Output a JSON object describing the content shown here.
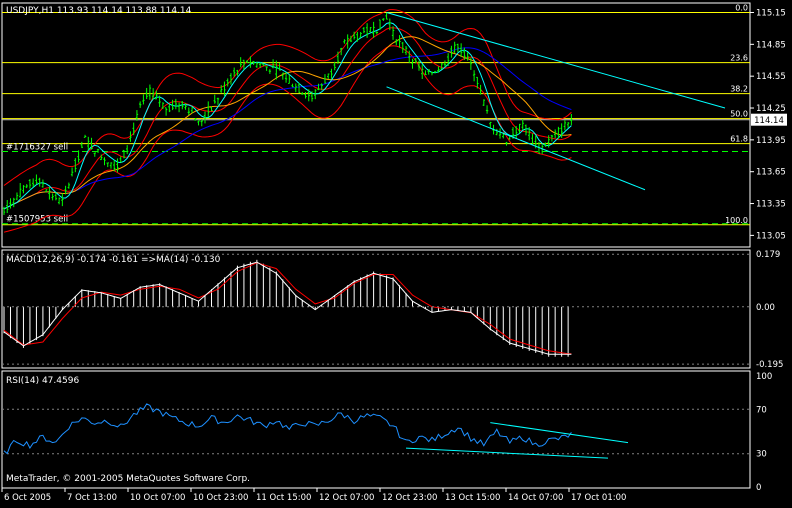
{
  "chart_data": {
    "type": "candlestick",
    "symbol": "USDJPY,H1",
    "title": "USDJPY,H1  113.93 114.14 113.88 114.14",
    "ohlc_header": [
      "113.93",
      "114.14",
      "113.88",
      "114.14"
    ],
    "current_price": 114.14,
    "current_price_label": "114.14",
    "price_ylim": [
      112.95,
      115.23
    ],
    "price_ticks": [
      "115.15",
      "114.85",
      "114.55",
      "114.25",
      "113.95",
      "113.65",
      "113.35",
      "113.05"
    ],
    "time_labels": [
      "6 Oct 2005",
      "7 Oct 13:00",
      "10 Oct 07:00",
      "10 Oct 23:00",
      "11 Oct 15:00",
      "12 Oct 07:00",
      "12 Oct 23:00",
      "13 Oct 15:00",
      "14 Oct 07:00",
      "17 Oct 01:00"
    ],
    "fibonacci": {
      "high": 115.15,
      "low": 113.15,
      "levels": [
        {
          "ratio": 0.0,
          "label": "0.0"
        },
        {
          "ratio": 0.236,
          "label": "23.6"
        },
        {
          "ratio": 0.382,
          "label": "38.2"
        },
        {
          "ratio": 0.5,
          "label": "50.0"
        },
        {
          "ratio": 0.618,
          "label": "61.8"
        },
        {
          "ratio": 1.0,
          "label": "100.0"
        }
      ]
    },
    "orders": [
      {
        "label": "#1716327 sell",
        "price": 113.84
      },
      {
        "label": "#1507953 sell",
        "price": 113.16
      }
    ],
    "price_path": [
      [
        0,
        113.3
      ],
      [
        5,
        113.45
      ],
      [
        10,
        113.58
      ],
      [
        15,
        113.42
      ],
      [
        18,
        113.36
      ],
      [
        22,
        113.72
      ],
      [
        25,
        113.95
      ],
      [
        30,
        113.8
      ],
      [
        35,
        113.7
      ],
      [
        38,
        113.88
      ],
      [
        42,
        114.25
      ],
      [
        45,
        114.4
      ],
      [
        50,
        114.25
      ],
      [
        55,
        114.3
      ],
      [
        58,
        114.22
      ],
      [
        60,
        114.1
      ],
      [
        65,
        114.3
      ],
      [
        70,
        114.55
      ],
      [
        75,
        114.7
      ],
      [
        80,
        114.65
      ],
      [
        85,
        114.6
      ],
      [
        90,
        114.45
      ],
      [
        95,
        114.35
      ],
      [
        100,
        114.55
      ],
      [
        105,
        114.85
      ],
      [
        110,
        114.95
      ],
      [
        115,
        115.0
      ],
      [
        118,
        115.12
      ],
      [
        120,
        114.95
      ],
      [
        125,
        114.75
      ],
      [
        130,
        114.55
      ],
      [
        135,
        114.65
      ],
      [
        140,
        114.85
      ],
      [
        145,
        114.6
      ],
      [
        150,
        114.1
      ],
      [
        155,
        113.95
      ],
      [
        160,
        114.1
      ],
      [
        165,
        113.85
      ],
      [
        170,
        114.0
      ],
      [
        175,
        114.14
      ]
    ],
    "macd": {
      "label": "MACD(12,26,9) -0.174 -0.161 =>MA(14) -0.130",
      "ylim": [
        -0.205,
        0.19
      ],
      "ticks": [
        "0.179",
        "0.00",
        "-0.195"
      ],
      "tick_values": [
        0.179,
        0.0,
        -0.195
      ],
      "histogram": [
        [
          0,
          -0.09
        ],
        [
          6,
          -0.14
        ],
        [
          12,
          -0.1
        ],
        [
          18,
          -0.01
        ],
        [
          24,
          0.06
        ],
        [
          30,
          0.05
        ],
        [
          36,
          0.03
        ],
        [
          42,
          0.07
        ],
        [
          48,
          0.08
        ],
        [
          54,
          0.05
        ],
        [
          60,
          0.02
        ],
        [
          66,
          0.08
        ],
        [
          72,
          0.14
        ],
        [
          78,
          0.16
        ],
        [
          84,
          0.12
        ],
        [
          90,
          0.04
        ],
        [
          96,
          -0.01
        ],
        [
          102,
          0.04
        ],
        [
          108,
          0.09
        ],
        [
          114,
          0.12
        ],
        [
          120,
          0.1
        ],
        [
          126,
          0.02
        ],
        [
          132,
          -0.02
        ],
        [
          138,
          -0.01
        ],
        [
          144,
          -0.02
        ],
        [
          150,
          -0.08
        ],
        [
          156,
          -0.13
        ],
        [
          162,
          -0.15
        ],
        [
          168,
          -0.17
        ],
        [
          174,
          -0.17
        ]
      ],
      "signal": [
        [
          0,
          -0.08
        ],
        [
          6,
          -0.13
        ],
        [
          12,
          -0.12
        ],
        [
          18,
          -0.04
        ],
        [
          24,
          0.03
        ],
        [
          30,
          0.05
        ],
        [
          36,
          0.04
        ],
        [
          42,
          0.06
        ],
        [
          48,
          0.07
        ],
        [
          54,
          0.06
        ],
        [
          60,
          0.03
        ],
        [
          66,
          0.06
        ],
        [
          72,
          0.12
        ],
        [
          78,
          0.15
        ],
        [
          84,
          0.13
        ],
        [
          90,
          0.06
        ],
        [
          96,
          0.01
        ],
        [
          102,
          0.03
        ],
        [
          108,
          0.08
        ],
        [
          114,
          0.11
        ],
        [
          120,
          0.11
        ],
        [
          126,
          0.04
        ],
        [
          132,
          0.0
        ],
        [
          138,
          -0.01
        ],
        [
          144,
          -0.02
        ],
        [
          150,
          -0.06
        ],
        [
          156,
          -0.11
        ],
        [
          162,
          -0.13
        ],
        [
          168,
          -0.15
        ],
        [
          174,
          -0.16
        ]
      ]
    },
    "rsi": {
      "label": "RSI(14) 47.4596",
      "ylim": [
        0,
        100
      ],
      "ticks": [
        "100",
        "70",
        "30",
        "0"
      ],
      "tick_values": [
        100,
        70,
        30,
        0
      ],
      "values": [
        [
          0,
          30
        ],
        [
          4,
          42
        ],
        [
          8,
          38
        ],
        [
          12,
          45
        ],
        [
          16,
          40
        ],
        [
          20,
          55
        ],
        [
          24,
          62
        ],
        [
          28,
          58
        ],
        [
          32,
          60
        ],
        [
          36,
          54
        ],
        [
          40,
          65
        ],
        [
          44,
          72
        ],
        [
          48,
          68
        ],
        [
          52,
          62
        ],
        [
          56,
          58
        ],
        [
          60,
          55
        ],
        [
          64,
          62
        ],
        [
          68,
          58
        ],
        [
          72,
          64
        ],
        [
          76,
          60
        ],
        [
          80,
          55
        ],
        [
          84,
          60
        ],
        [
          88,
          52
        ],
        [
          92,
          58
        ],
        [
          96,
          55
        ],
        [
          100,
          60
        ],
        [
          104,
          66
        ],
        [
          108,
          60
        ],
        [
          112,
          64
        ],
        [
          116,
          62
        ],
        [
          120,
          55
        ],
        [
          124,
          40
        ],
        [
          128,
          45
        ],
        [
          132,
          42
        ],
        [
          136,
          48
        ],
        [
          140,
          54
        ],
        [
          144,
          44
        ],
        [
          148,
          38
        ],
        [
          152,
          50
        ],
        [
          156,
          40
        ],
        [
          160,
          45
        ],
        [
          164,
          38
        ],
        [
          168,
          42
        ],
        [
          172,
          44
        ],
        [
          175,
          47.46
        ]
      ]
    },
    "copyright": "MetaTrader, © 2001-2005 MetaQuotes Software Corp."
  },
  "colors": {
    "background": "#000000",
    "candle": "#00ff00",
    "bollinger": "#ff0000",
    "ma_fast": "#00ffff",
    "ma_mid": "#ffa500",
    "ma_slow": "#0000ff",
    "fib": "#ffff00",
    "order": "#00ff00",
    "channel": "#00ffff",
    "macd_hist": "#ffffff",
    "macd_signal": "#ff0000",
    "rsi": "#1e90ff",
    "grid": "#ffffff"
  }
}
